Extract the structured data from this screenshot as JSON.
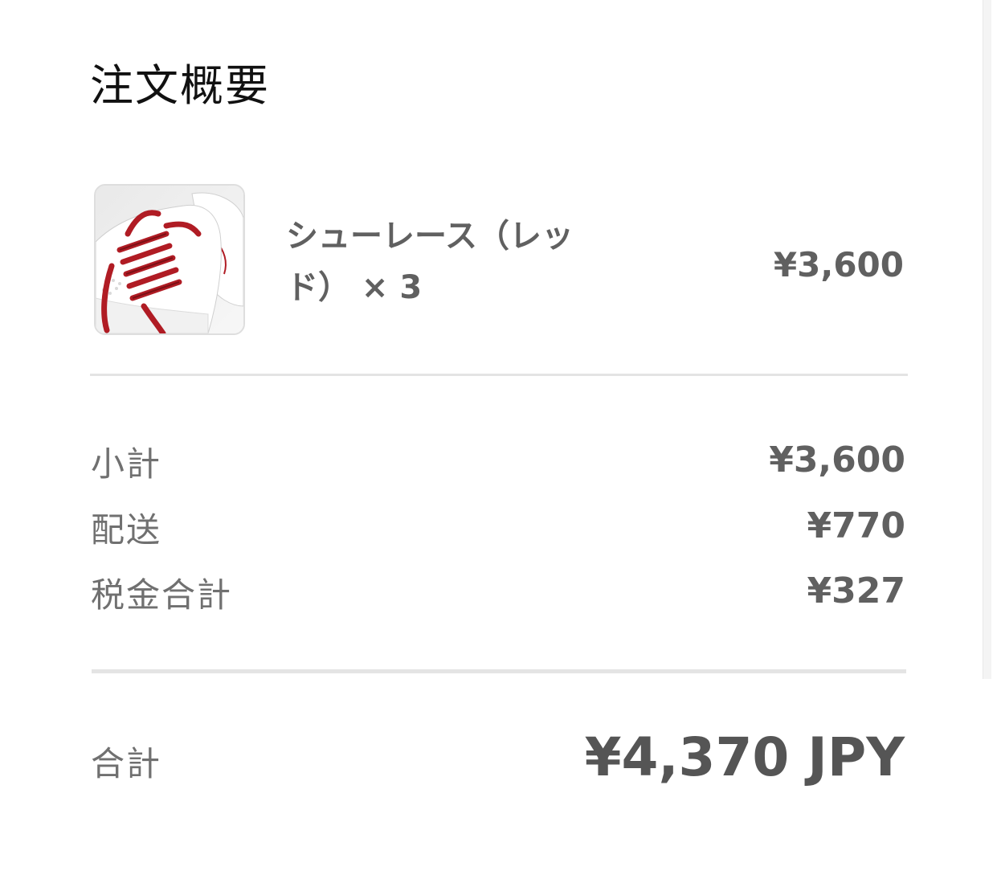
{
  "header": {
    "title": "注文概要"
  },
  "item": {
    "name": "シューレース（レッド） × 3",
    "price": "¥3,600",
    "image_icon": "shoelace-product-image"
  },
  "summary": {
    "rows": [
      {
        "label": "小計",
        "value": "¥3,600"
      },
      {
        "label": "配送",
        "value": "¥770"
      },
      {
        "label": "税金合計",
        "value": "¥327"
      }
    ]
  },
  "total": {
    "label": "合計",
    "value": "¥4,370 JPY"
  },
  "colors": {
    "accent_laces": "#b01c24",
    "text_primary": "#111111",
    "text_secondary": "#606060"
  }
}
